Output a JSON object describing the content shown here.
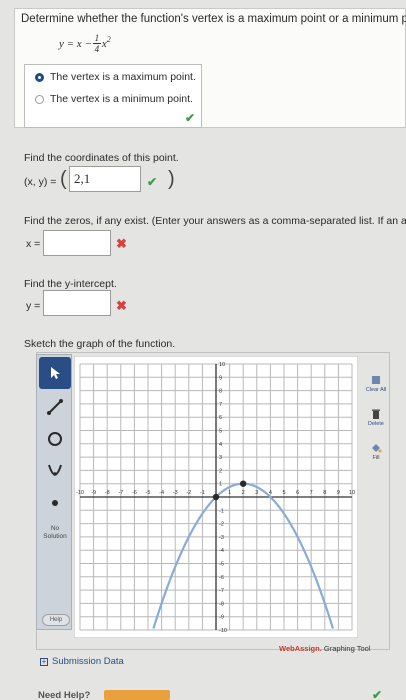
{
  "question": {
    "text": "Determine whether the function's vertex is a maximum point or a minimum poir",
    "func_lhs": "y = x −",
    "func_num": "1",
    "func_den": "4",
    "func_var": "x",
    "func_exp": "2"
  },
  "vertex_choice": {
    "options": [
      {
        "label": "The vertex is a maximum point.",
        "selected": true
      },
      {
        "label": "The vertex is a minimum point.",
        "selected": false
      }
    ],
    "result_mark": "✔"
  },
  "coords": {
    "prompt": "Find the coordinates of this point.",
    "lhs": "(x, y) =",
    "value": "2,1",
    "result_mark": "✔",
    "open_paren": "(",
    "close_paren": ")"
  },
  "zeros": {
    "prompt": "Find the zeros, if any exist. (Enter your answers as a comma-separated list. If an a",
    "lhs": "x =",
    "value": "",
    "result_mark": "✖"
  },
  "yintercept": {
    "prompt": "Find the y-intercept.",
    "lhs": "y =",
    "value": "",
    "result_mark": "✖"
  },
  "sketch": {
    "prompt": "Sketch the graph of the function."
  },
  "graph_tool": {
    "no_solution": "No Solution",
    "clear_all": "Clear All",
    "delete": "Delete",
    "fill": "Fill",
    "help": "Help",
    "brand": "WebAssign.",
    "brand_suffix": "Graphing Tool",
    "x_tick_labels": [
      "-10",
      "-9",
      "-8",
      "-7",
      "-6",
      "-5",
      "-4",
      "-3",
      "-2",
      "-1",
      "1",
      "2",
      "3",
      "4",
      "5",
      "6",
      "7",
      "8",
      "9",
      "10"
    ],
    "y_tick_labels": [
      "10",
      "9",
      "8",
      "7",
      "6",
      "5",
      "4",
      "3",
      "2",
      "1",
      "-1",
      "-2",
      "-3",
      "-4",
      "-5",
      "-6",
      "-7",
      "-8",
      "-9",
      "-10"
    ]
  },
  "chart_data": {
    "type": "line",
    "xlim": [
      -10,
      10
    ],
    "ylim": [
      -10,
      10
    ],
    "grid": true,
    "points": [
      {
        "x": 0,
        "y": 0
      },
      {
        "x": 2,
        "y": 1
      }
    ],
    "curve": {
      "a": -0.25,
      "b": 1,
      "c": 0,
      "color": "#8aabd8"
    }
  },
  "submission": {
    "label": "Submission Data",
    "toggle": "+"
  },
  "need_help": {
    "label": "Need Help?"
  },
  "colors": {
    "accent": "#2a4d86",
    "correct": "#3d9d48",
    "wrong": "#d9403f",
    "curve": "#8aabd8"
  }
}
